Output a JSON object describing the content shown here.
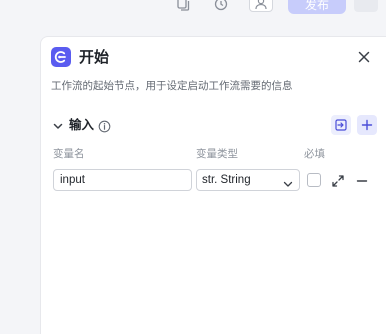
{
  "colors": {
    "accent": "#5a5cf0",
    "publish_button": "#c7ccfb",
    "panel_background": "#ffffff",
    "page_background": "#f4f5f8"
  },
  "topbar": {
    "icons": [
      "copy-icon",
      "history-icon",
      "user-icon"
    ],
    "publish_label": "发布"
  },
  "panel": {
    "icon": "start-node-icon",
    "title": "开始",
    "description": "工作流的起始节点，用于设定启动工作流需要的信息",
    "close_icon": "close-icon",
    "input_section": {
      "title": "输入",
      "info_icon": "info-icon",
      "import_icon": "import-icon",
      "add_icon": "plus-icon",
      "columns": [
        "变量名",
        "变量类型",
        "必填"
      ],
      "rows": [
        {
          "name": "input",
          "type_prefix": "str.",
          "type": "String",
          "required": false
        }
      ]
    }
  }
}
